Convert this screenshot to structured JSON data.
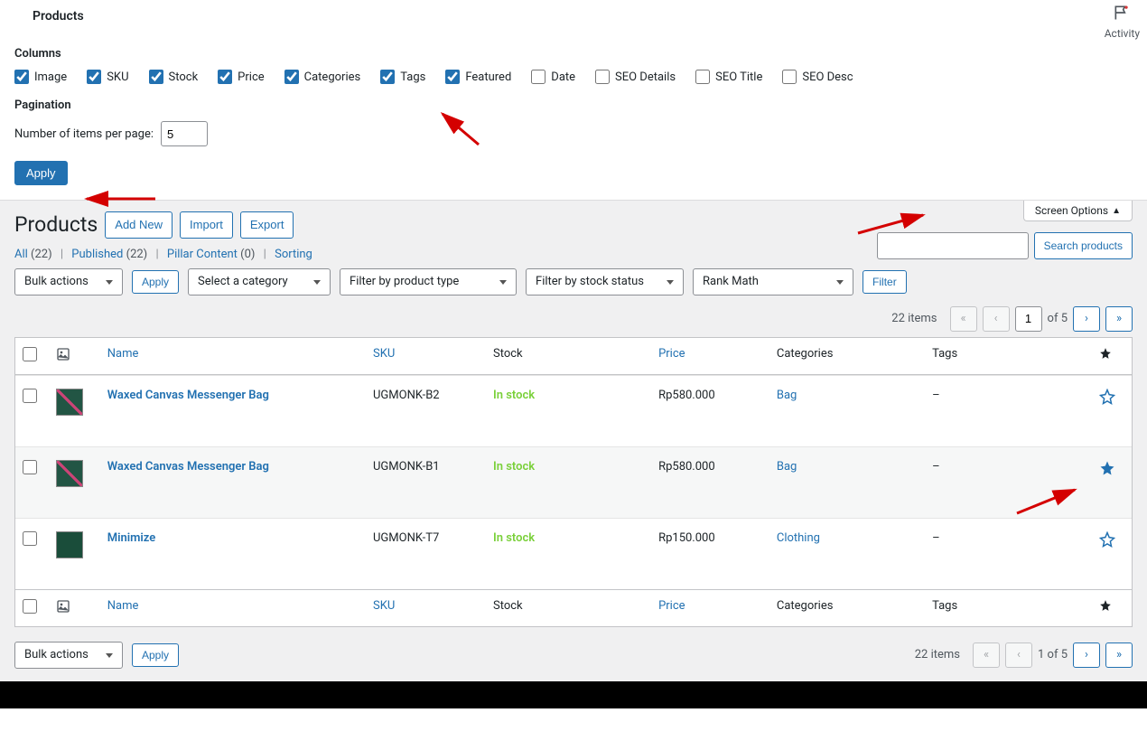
{
  "topnav": {
    "activity": "Activity",
    "crumb": "Products"
  },
  "screen_options": {
    "columns_heading": "Columns",
    "columns": [
      {
        "label": "Image",
        "checked": true
      },
      {
        "label": "SKU",
        "checked": true
      },
      {
        "label": "Stock",
        "checked": true
      },
      {
        "label": "Price",
        "checked": true
      },
      {
        "label": "Categories",
        "checked": true
      },
      {
        "label": "Tags",
        "checked": true
      },
      {
        "label": "Featured",
        "checked": true
      },
      {
        "label": "Date",
        "checked": false
      },
      {
        "label": "SEO Details",
        "checked": false
      },
      {
        "label": "SEO Title",
        "checked": false
      },
      {
        "label": "SEO Desc",
        "checked": false
      }
    ],
    "pagination_heading": "Pagination",
    "items_per_page_label": "Number of items per page:",
    "items_per_page_value": "5",
    "apply_button": "Apply"
  },
  "page": {
    "title": "Products",
    "add_new": "Add New",
    "import": "Import",
    "export": "Export",
    "screen_options_toggle": "Screen Options"
  },
  "views": {
    "all": "All",
    "all_count": "(22)",
    "published": "Published",
    "published_count": "(22)",
    "pillar": "Pillar Content",
    "pillar_count": "(0)",
    "sorting": "Sorting"
  },
  "filters": {
    "bulk_actions": "Bulk actions",
    "apply_btn": "Apply",
    "category": "Select a category",
    "product_type": "Filter by product type",
    "stock_status": "Filter by stock status",
    "rank_math": "Rank Math",
    "filter_btn": "Filter"
  },
  "search": {
    "button": "Search products"
  },
  "pagination": {
    "items_count": "22 items",
    "current": "1",
    "of_text": "of 5",
    "one_of": "1 of 5"
  },
  "columns_header": {
    "name": "Name",
    "sku": "SKU",
    "stock": "Stock",
    "price": "Price",
    "categories": "Categories",
    "tags": "Tags"
  },
  "products": [
    {
      "name": "Waxed Canvas Messenger Bag",
      "sku": "UGMONK-B2",
      "stock": "In stock",
      "price": "Rp580.000",
      "cat": "Bag",
      "tag": "–",
      "featured": false,
      "img": "navy"
    },
    {
      "name": "Waxed Canvas Messenger Bag",
      "sku": "UGMONK-B1",
      "stock": "In stock",
      "price": "Rp580.000",
      "cat": "Bag",
      "tag": "–",
      "featured": true,
      "img": "navy"
    },
    {
      "name": "Minimize",
      "sku": "UGMONK-T7",
      "stock": "In stock",
      "price": "Rp150.000",
      "cat": "Clothing",
      "tag": "–",
      "featured": false,
      "img": "green"
    }
  ]
}
